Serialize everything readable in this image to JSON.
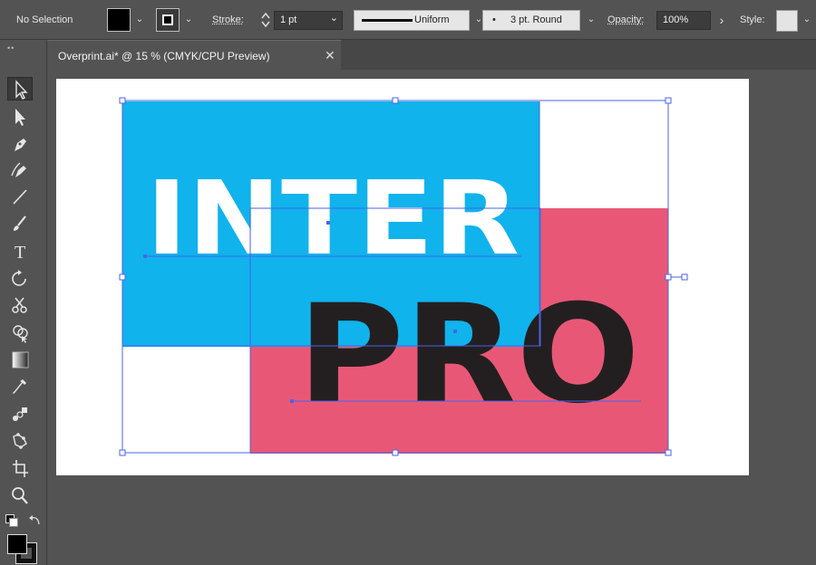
{
  "control_bar": {
    "selection_label": "No Selection",
    "stroke_label": "Stroke:",
    "stroke_weight": "1 pt",
    "profile_label": "Uniform",
    "brush_label": "3 pt. Round",
    "brush_dot": "•",
    "opacity_label": "Opacity:",
    "opacity_value": "100%",
    "style_label": "Style:",
    "chevron": "⌄",
    "arrow": "›"
  },
  "document": {
    "tab_title": "Overprint.ai* @ 15 % (CMYK/CPU Preview)",
    "close_glyph": "✕"
  },
  "toolbar": {
    "grip": "••",
    "tools": [
      {
        "name": "selection-tool",
        "icon": "arrow-outline-icon"
      },
      {
        "name": "direct-selection-tool",
        "icon": "arrow-solid-icon"
      },
      {
        "name": "pen-tool",
        "icon": "pen-icon"
      },
      {
        "name": "curvature-tool",
        "icon": "curvature-pen-icon"
      },
      {
        "name": "line-segment-tool",
        "icon": "line-icon"
      },
      {
        "name": "paintbrush-tool",
        "icon": "brush-icon"
      },
      {
        "name": "type-tool",
        "icon": "type-icon"
      },
      {
        "name": "rotate-tool",
        "icon": "rotate-icon"
      },
      {
        "name": "scissors-tool",
        "icon": "scissors-icon"
      },
      {
        "name": "shape-builder-tool",
        "icon": "shape-builder-icon"
      },
      {
        "name": "gradient-tool",
        "icon": "gradient-icon"
      },
      {
        "name": "eyedropper-tool",
        "icon": "eyedropper-icon"
      },
      {
        "name": "blend-tool",
        "icon": "blend-icon"
      },
      {
        "name": "puppet-warp-tool",
        "icon": "puppet-warp-icon"
      },
      {
        "name": "artboard-tool",
        "icon": "artboard-icon"
      },
      {
        "name": "zoom-tool",
        "icon": "magnifier-icon"
      }
    ],
    "type_glyph": "T"
  },
  "artwork": {
    "word_top": "INTER",
    "word_bottom": "PRO",
    "colors": {
      "cyan": "#10b3ec",
      "pink": "#e85876",
      "white": "#ffffff",
      "black": "#231f20",
      "selection": "#4a63e8"
    }
  }
}
